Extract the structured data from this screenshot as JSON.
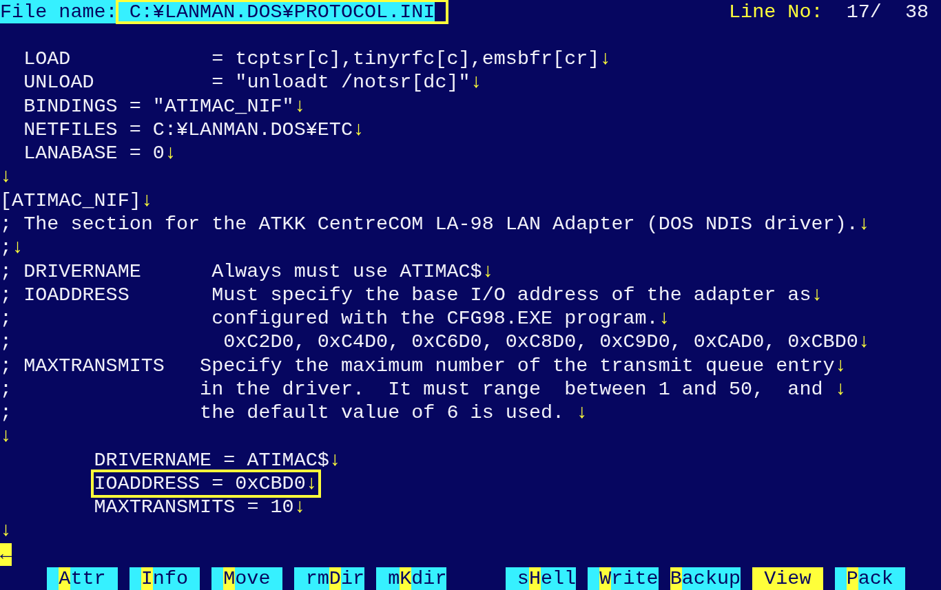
{
  "header": {
    "file_label": "File name:",
    "file_name": "C:¥LANMAN.DOS¥PROTOCOL.INI",
    "file_highlighted": true,
    "line_label": "Line No:",
    "line_value": "17/  38"
  },
  "lines": [
    {
      "kind": "blank"
    },
    {
      "kind": "line",
      "text": "  LOAD            = tcptsr[c],tinyrfc[c],emsbfr[cr]",
      "mark": "↓",
      "highlighted": false
    },
    {
      "kind": "line",
      "text": "  UNLOAD          = \"unloadt /notsr[dc]\"",
      "mark": "↓",
      "highlighted": false
    },
    {
      "kind": "line",
      "text": "  BINDINGS = \"ATIMAC_NIF\"",
      "mark": "↓",
      "highlighted": false
    },
    {
      "kind": "line",
      "text": "  NETFILES = C:¥LANMAN.DOS¥ETC",
      "mark": "↓",
      "highlighted": false
    },
    {
      "kind": "line",
      "text": "  LANABASE = 0",
      "mark": "↓",
      "highlighted": false
    },
    {
      "kind": "line",
      "mark": "↓",
      "highlighted": false
    },
    {
      "kind": "line",
      "text": "[ATIMAC_NIF]",
      "mark": "↓",
      "highlighted": false
    },
    {
      "kind": "line",
      "text": "; The section for the ATKK CentreCOM LA-98 LAN Adapter (DOS NDIS driver).",
      "mark": "↓",
      "highlighted": false
    },
    {
      "kind": "line",
      "text": ";",
      "mark": "↓",
      "highlighted": false
    },
    {
      "kind": "line",
      "text": "; DRIVERNAME      Always must use ATIMAC$",
      "mark": "↓",
      "highlighted": false
    },
    {
      "kind": "line",
      "text": "; IOADDRESS       Must specify the base I/O address of the adapter as",
      "mark": "↓",
      "highlighted": false
    },
    {
      "kind": "line",
      "text": ";                 configured with the CFG98.EXE program.",
      "mark": "↓",
      "highlighted": false
    },
    {
      "kind": "line",
      "text": ";                  0xC2D0, 0xC4D0, 0xC6D0, 0xC8D0, 0xC9D0, 0xCAD0, 0xCBD0",
      "mark": "↓",
      "highlighted": false
    },
    {
      "kind": "line",
      "text": "; MAXTRANSMITS   Specify the maximum number of the transmit queue entry",
      "mark": "↓",
      "highlighted": false
    },
    {
      "kind": "line",
      "text": ";                in the driver.  It must range  between 1 and 50,  and ",
      "mark": "↓",
      "highlighted": false
    },
    {
      "kind": "line",
      "text": ";                the default value of 6 is used. ",
      "mark": "↓",
      "highlighted": false
    },
    {
      "kind": "line",
      "mark": "↓",
      "highlighted": false
    },
    {
      "kind": "line",
      "text": "        DRIVERNAME = ATIMAC$",
      "mark": "↓",
      "highlighted": false
    },
    {
      "kind": "line",
      "text": "        IOADDRESS = 0xCBD0",
      "mark": "↓",
      "highlighted": true
    },
    {
      "kind": "line",
      "text": "        MAXTRANSMITS = 10",
      "mark": "↓",
      "highlighted": false
    },
    {
      "kind": "line",
      "mark": "↓",
      "highlighted": false
    },
    {
      "kind": "eof",
      "mark": "←"
    }
  ],
  "function_key_groups": [
    [
      {
        "key": "A",
        "after": "ttr",
        "selected": false
      },
      {
        "key": "I",
        "after": "nfo",
        "selected": false
      },
      {
        "key": "M",
        "after": "ove",
        "selected": false
      },
      {
        "before": "rm",
        "key": "D",
        "after": "ir",
        "selected": false
      },
      {
        "before": "m",
        "key": "K",
        "after": "dir",
        "selected": false
      }
    ],
    [
      {
        "before": "s",
        "key": "H",
        "after": "ell",
        "selected": false
      },
      {
        "key": "W",
        "after": "rite",
        "selected": false
      },
      {
        "key": "B",
        "after": "ackup",
        "selected": false
      },
      {
        "key": "V",
        "after": "iew",
        "selected": true
      },
      {
        "key": "P",
        "after": "ack",
        "selected": false
      }
    ]
  ]
}
